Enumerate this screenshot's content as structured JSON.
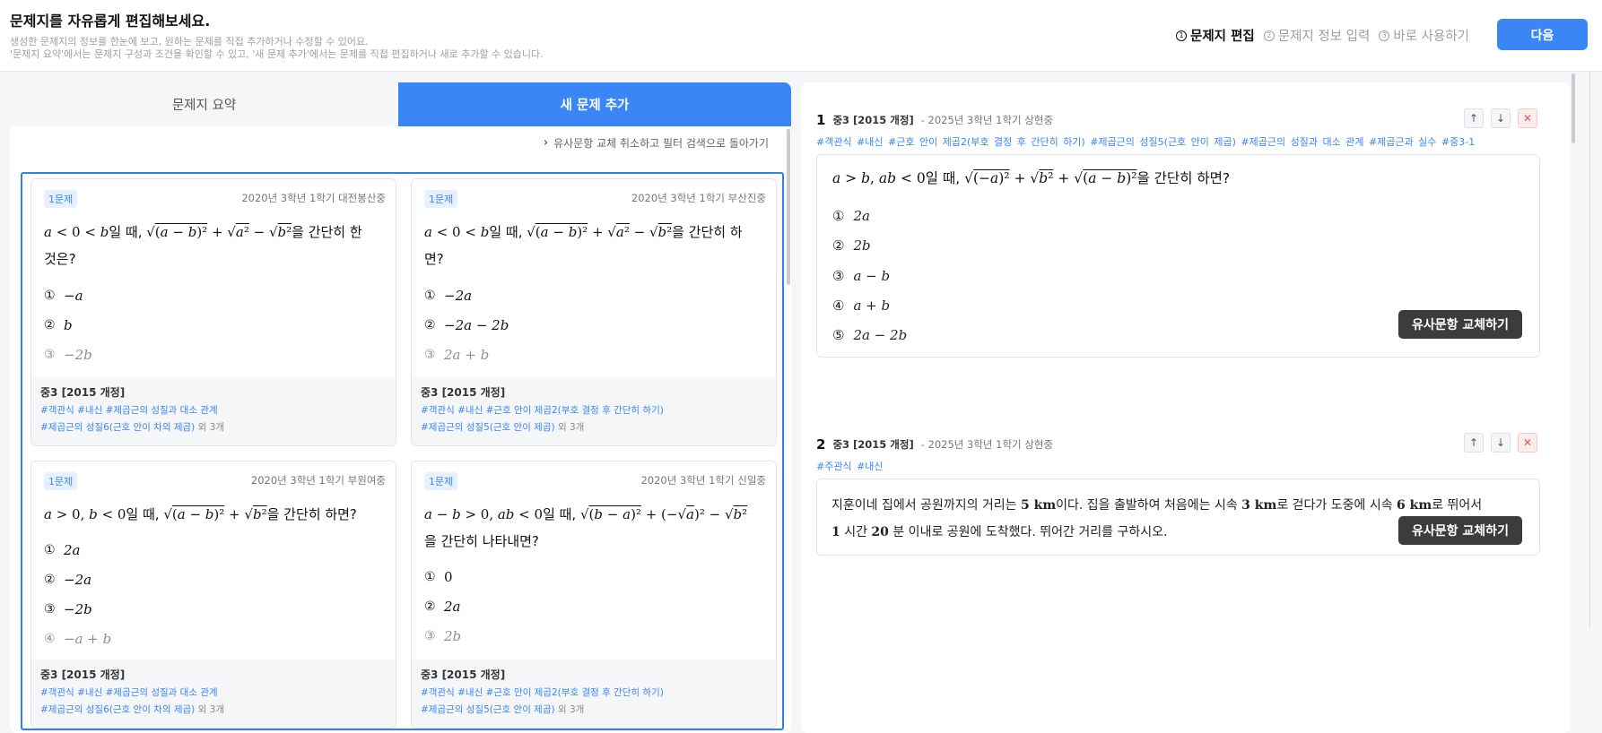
{
  "header": {
    "title": "문제지를 자유롭게 편집해보세요.",
    "sub1": "생성한 문제지의 정보를 한눈에 보고, 원하는 문제를 직접 추가하거나 수정할 수 있어요.",
    "sub2": "'문제지 요약'에서는 문제지 구성과 조건을 확인할 수 있고, '새 문제 추가'에서는 문제를 직접 편집하거나 새로 추가할 수 있습니다.",
    "steps": [
      {
        "num": "1",
        "label": "문제지 편집"
      },
      {
        "num": "2",
        "label": "문제지 정보 입력"
      },
      {
        "num": "3",
        "label": "바로 사용하기"
      }
    ],
    "next_label": "다음"
  },
  "left": {
    "tabs": [
      "문제지 요약",
      "새 문제 추가"
    ],
    "back_link": "유사문항 교체 취소하고 필터 검색으로 돌아가기",
    "cards": [
      {
        "badge": "1문제",
        "source": "2020년 3학년 1학기 대전봉산중",
        "choices": [
          {
            "n": "①",
            "v": "−a"
          },
          {
            "n": "②",
            "v": "b"
          },
          {
            "n": "③",
            "v": "−2b"
          }
        ],
        "grade": "중3 [2015 개정]",
        "tags1": "#객관식  #내신  #제곱근의 성질과 대소 관계",
        "tags2": "#제곱근의 성질6(근호 안이 차의 제곱)",
        "more": "외 3개"
      },
      {
        "badge": "1문제",
        "source": "2020년 3학년 1학기 부산진중",
        "choices": [
          {
            "n": "①",
            "v": "−2a"
          },
          {
            "n": "②",
            "v": "−2a − 2b"
          },
          {
            "n": "③",
            "v": "2a + b"
          }
        ],
        "grade": "중3 [2015 개정]",
        "tags1": "#객관식  #내신  #근호 안이 제곱2(부호 결정 후 간단히 하기)",
        "tags2": "#제곱근의 성질5(근호 안이 제곱)",
        "more": "외 3개"
      },
      {
        "badge": "1문제",
        "source": "2020년 3학년 1학기 부원여중",
        "choices": [
          {
            "n": "①",
            "v": "2a"
          },
          {
            "n": "②",
            "v": "−2a"
          },
          {
            "n": "③",
            "v": "−2b"
          },
          {
            "n": "④",
            "v": "−a + b"
          }
        ],
        "grade": "중3 [2015 개정]",
        "tags1": "#객관식  #내신  #제곱근의 성질과 대소 관계",
        "tags2": "#제곱근의 성질6(근호 안이 차의 제곱)",
        "more": "외 3개"
      },
      {
        "badge": "1문제",
        "source": "2020년 3학년 1학기 신일중",
        "choices": [
          {
            "n": "①",
            "v": "0"
          },
          {
            "n": "②",
            "v": "2a"
          },
          {
            "n": "③",
            "v": "2b"
          }
        ],
        "grade": "중3 [2015 개정]",
        "tags1": "#객관식  #내신  #근호 안이 제곱2(부호 결정 후 간단히 하기)",
        "tags2": "#제곱근의 성질5(근호 안이 제곱)",
        "more": "외 3개"
      }
    ],
    "card1_tail": "을 간단히 한",
    "card1_tail2": "것은?",
    "card2_tail": "을 간단히 하",
    "card2_tail2": "면?",
    "card3_tail": "을 간단히 하면?",
    "card4_tail2": "을 간단히 나타내면?"
  },
  "right": {
    "items": [
      {
        "num": "1",
        "grade": "중3 [2015 개정]",
        "source": "- 2025년 3학년 1학기 상현중",
        "tags": "#객관식 #내신 #근호 안이 제곱2(부호 결정 후 간단히 하기) #제곱근의 성질5(근호 안이 제곱) #제곱근의 성질과 대소 관계 #제곱근과 실수 #중3-1",
        "q_tail": "을 간단히 하면?",
        "choices": [
          {
            "n": "①",
            "v": "2a"
          },
          {
            "n": "②",
            "v": "2b"
          },
          {
            "n": "③",
            "v": "a − b"
          },
          {
            "n": "④",
            "v": "a + b"
          },
          {
            "n": "⑤",
            "v": "2a − 2b"
          }
        ]
      },
      {
        "num": "2",
        "grade": "중3 [2015 개정]",
        "source": "- 2025년 3학년 1학기 상현중",
        "tags": "#주관식 #내신"
      }
    ],
    "replace_label": "유사문항 교체하기",
    "item2": {
      "t1": "지훈이네 집에서 공원까지의 거리는 ",
      "v1": "5 km",
      "t2": "이다. 집을 출발하여 처음에는 시속 ",
      "v2": "3 km",
      "t3": "로 걷다가 도중에 시속 ",
      "v3": "6 km",
      "t4": "로 뛰어서",
      "v4": "1",
      "t5": " 시간 ",
      "v5": "20",
      "t6": " 분 이내로 공원에 도착했다. 뛰어간 거리를 구하시오."
    }
  }
}
